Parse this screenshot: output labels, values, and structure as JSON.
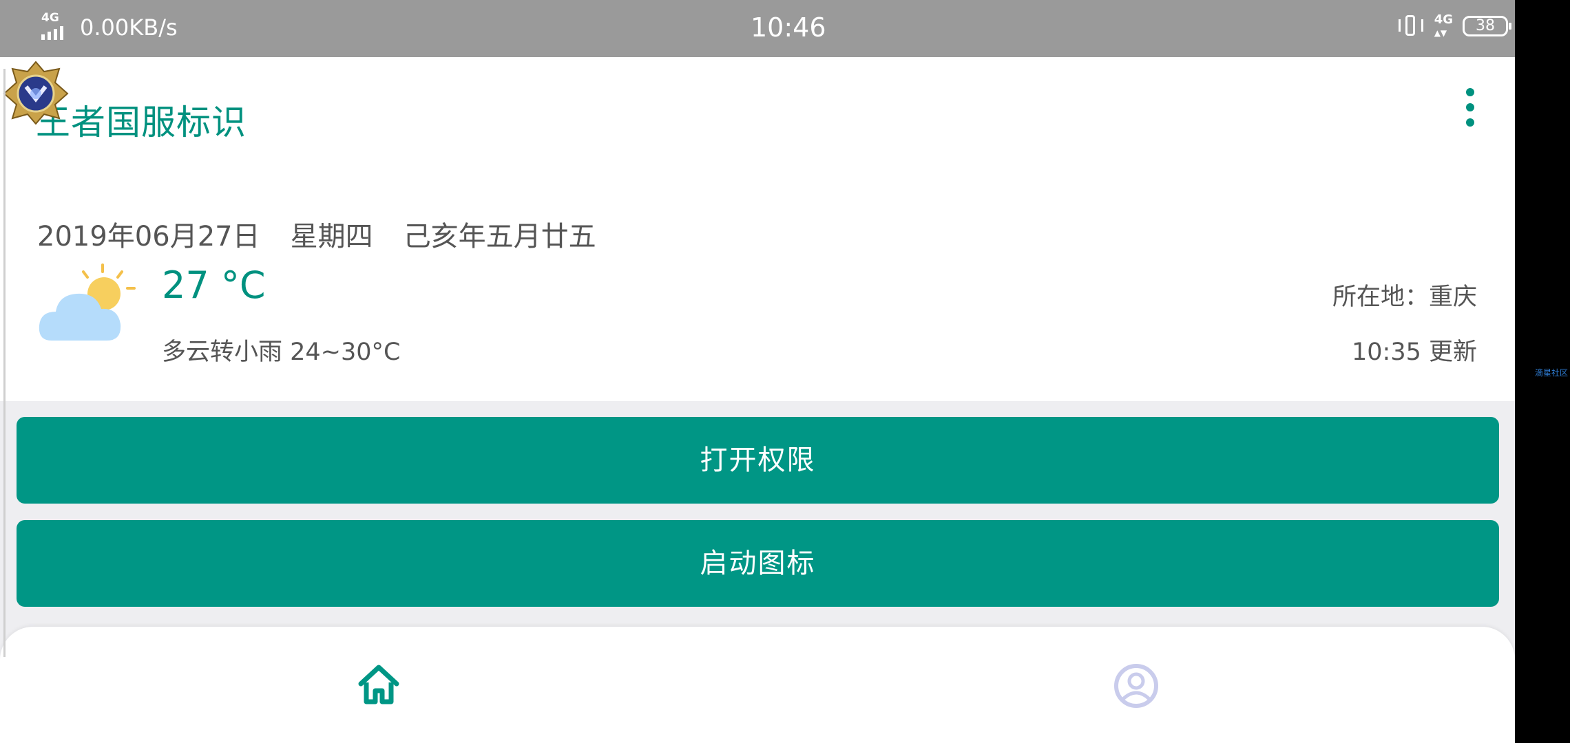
{
  "status_bar": {
    "network_type": "4G",
    "speed": "0.00KB/s",
    "time": "10:46",
    "right_network": "4G",
    "battery": "38"
  },
  "app": {
    "title": "王者国服标识",
    "menu_icon": "more-vert-icon",
    "accent_color": "#009685"
  },
  "info": {
    "date": "2019年06月27日",
    "weekday": "星期四",
    "lunar": "己亥年五月廿五",
    "temperature": "27 °C",
    "weather_desc": "多云转小雨 24~30°C",
    "location": "所在地：重庆",
    "update_time": "10:35 更新"
  },
  "buttons": {
    "open_permission": "打开权限",
    "start_icon": "启动图标"
  },
  "bottom_nav": {
    "home_icon": "home-icon",
    "profile_icon": "user-circle-icon"
  },
  "side_label": "滴星社区"
}
